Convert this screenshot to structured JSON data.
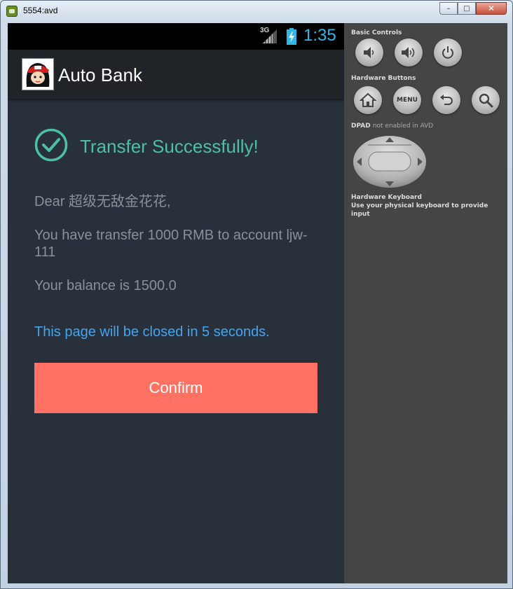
{
  "window": {
    "title": "5554:avd",
    "minimize": "–",
    "maximize": "□",
    "close": "✕"
  },
  "status_bar": {
    "network": "3G",
    "time": "1:35",
    "signal_icon": "signal-icon",
    "battery_icon": "battery-charging-icon"
  },
  "action_bar": {
    "title": "Auto Bank",
    "avatar_icon": "app-avatar-icon"
  },
  "content": {
    "success_title": "Transfer Successfully!",
    "success_icon": "check-circle-icon",
    "greeting": "Dear 超级无敌金花花,",
    "transfer_message": "You have transfer 1000 RMB to account ljw-111",
    "balance_message": "Your balance is 1500.0",
    "countdown_message": "This page will be closed in 5 seconds.",
    "confirm_label": "Confirm"
  },
  "controls_panel": {
    "basic_controls_label": "Basic Controls",
    "hardware_buttons_label": "Hardware Buttons",
    "menu_label": "MENU",
    "dpad_label": "DPAD",
    "dpad_note": "not enabled in AVD",
    "keyboard_label": "Hardware Keyboard",
    "keyboard_note": "Use your physical keyboard to provide input"
  },
  "colors": {
    "accent_teal": "#4dbfa7",
    "accent_blue": "#42a5f0",
    "confirm_button": "#ff7162",
    "background": "#27303b",
    "clock_blue": "#33b5e5"
  }
}
